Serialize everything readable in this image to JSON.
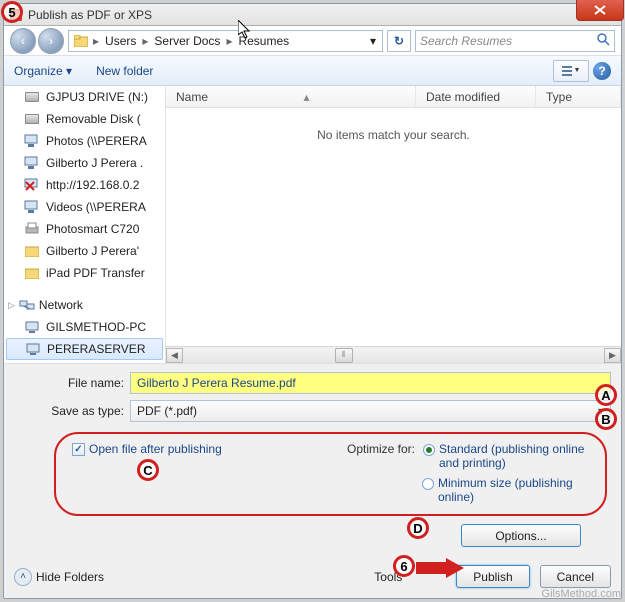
{
  "window": {
    "title": "Publish as PDF or XPS"
  },
  "nav": {
    "back": "‹",
    "forward": "›",
    "breadcrumb": [
      "Users",
      "Server Docs",
      "Resumes"
    ],
    "refresh_icon": "↻",
    "search_placeholder": "Search Resumes"
  },
  "toolbar": {
    "organize": "Organize ▾",
    "new_folder": "New folder",
    "help": "?"
  },
  "sidebar": {
    "items": [
      "GJPU3 DRIVE (N:)",
      "Removable Disk (",
      "Photos (\\\\PERERA",
      "Gilberto J Perera .",
      "http://192.168.0.2",
      "Videos (\\\\PERERA",
      "Photosmart C720",
      "Gilberto J Perera'",
      "iPad PDF Transfer"
    ],
    "network_label": "Network",
    "network_items": [
      "GILSMETHOD-PC",
      "PERERASERVER"
    ]
  },
  "columns": {
    "name": "Name",
    "date": "Date modified",
    "type": "Type"
  },
  "main": {
    "empty_text": "No items match your search."
  },
  "form": {
    "filename_label": "File name:",
    "filename_value": "Gilberto J Perera Resume.pdf",
    "savetype_label": "Save as type:",
    "savetype_value": "PDF (*.pdf)",
    "open_after": "Open file after publishing",
    "optimize_label": "Optimize for:",
    "optimize_standard": "Standard (publishing online and printing)",
    "optimize_minimum": "Minimum size (publishing online)",
    "options_btn": "Options...",
    "hide_folders": "Hide Folders",
    "tools": "Tools",
    "publish": "Publish",
    "cancel": "Cancel"
  },
  "markers": {
    "m5": "5",
    "mA": "A",
    "mB": "B",
    "mC": "C",
    "mD": "D",
    "m6": "6"
  },
  "watermark": "GilsMethod.com"
}
